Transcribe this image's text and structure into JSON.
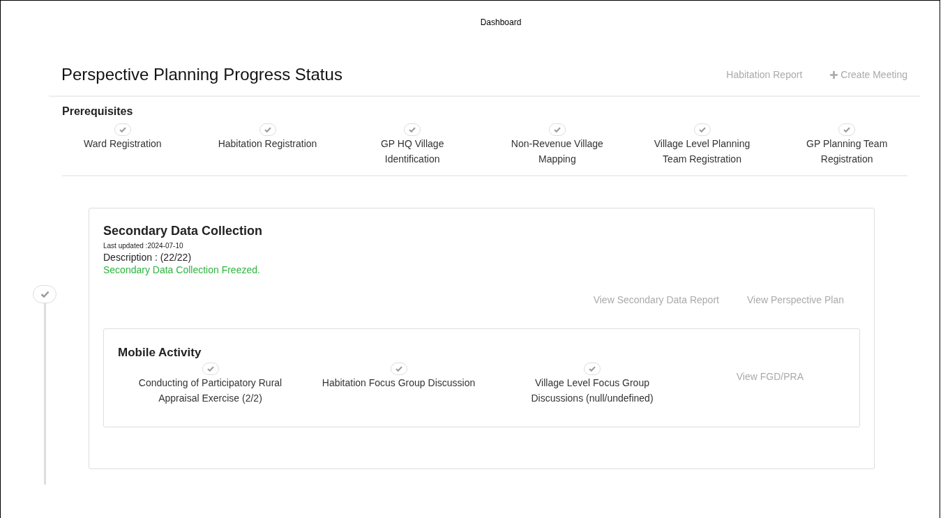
{
  "top_bar": {
    "title": "Dashboard"
  },
  "header": {
    "title": "Perspective Planning Progress Status",
    "links": [
      {
        "label": "Habitation Report",
        "kind": "plain"
      },
      {
        "label": "Create Meeting",
        "kind": "add"
      }
    ]
  },
  "prerequisites": {
    "title": "Prerequisites",
    "steps": [
      {
        "label": "Ward Registration",
        "done": true
      },
      {
        "label": "Habitation Registration",
        "done": true
      },
      {
        "label": "GP HQ Village Identification",
        "done": true
      },
      {
        "label": "Non-Revenue Village Mapping",
        "done": true
      },
      {
        "label": "Village Level Planning Team Registration",
        "done": true
      },
      {
        "label": "GP Planning Team Registration",
        "done": true
      }
    ]
  },
  "stage": {
    "done": true,
    "title": "Secondary Data Collection",
    "last_updated": "Last updated :2024-07-10",
    "description": "Description : (22/22)",
    "status": "Secondary Data Collection Freezed.",
    "links": [
      "View Secondary Data Report",
      "View Perspective Plan"
    ],
    "mobile_activity": {
      "title": "Mobile Activity",
      "steps": [
        {
          "label": "Conducting of Participatory Rural Appraisal Exercise (2/2)",
          "done": true
        },
        {
          "label": "Habitation Focus Group Discussion",
          "done": true
        },
        {
          "label": "Village Level Focus Group Discussions (null/undefined)",
          "done": true
        }
      ],
      "link": "View FGD/PRA"
    }
  }
}
